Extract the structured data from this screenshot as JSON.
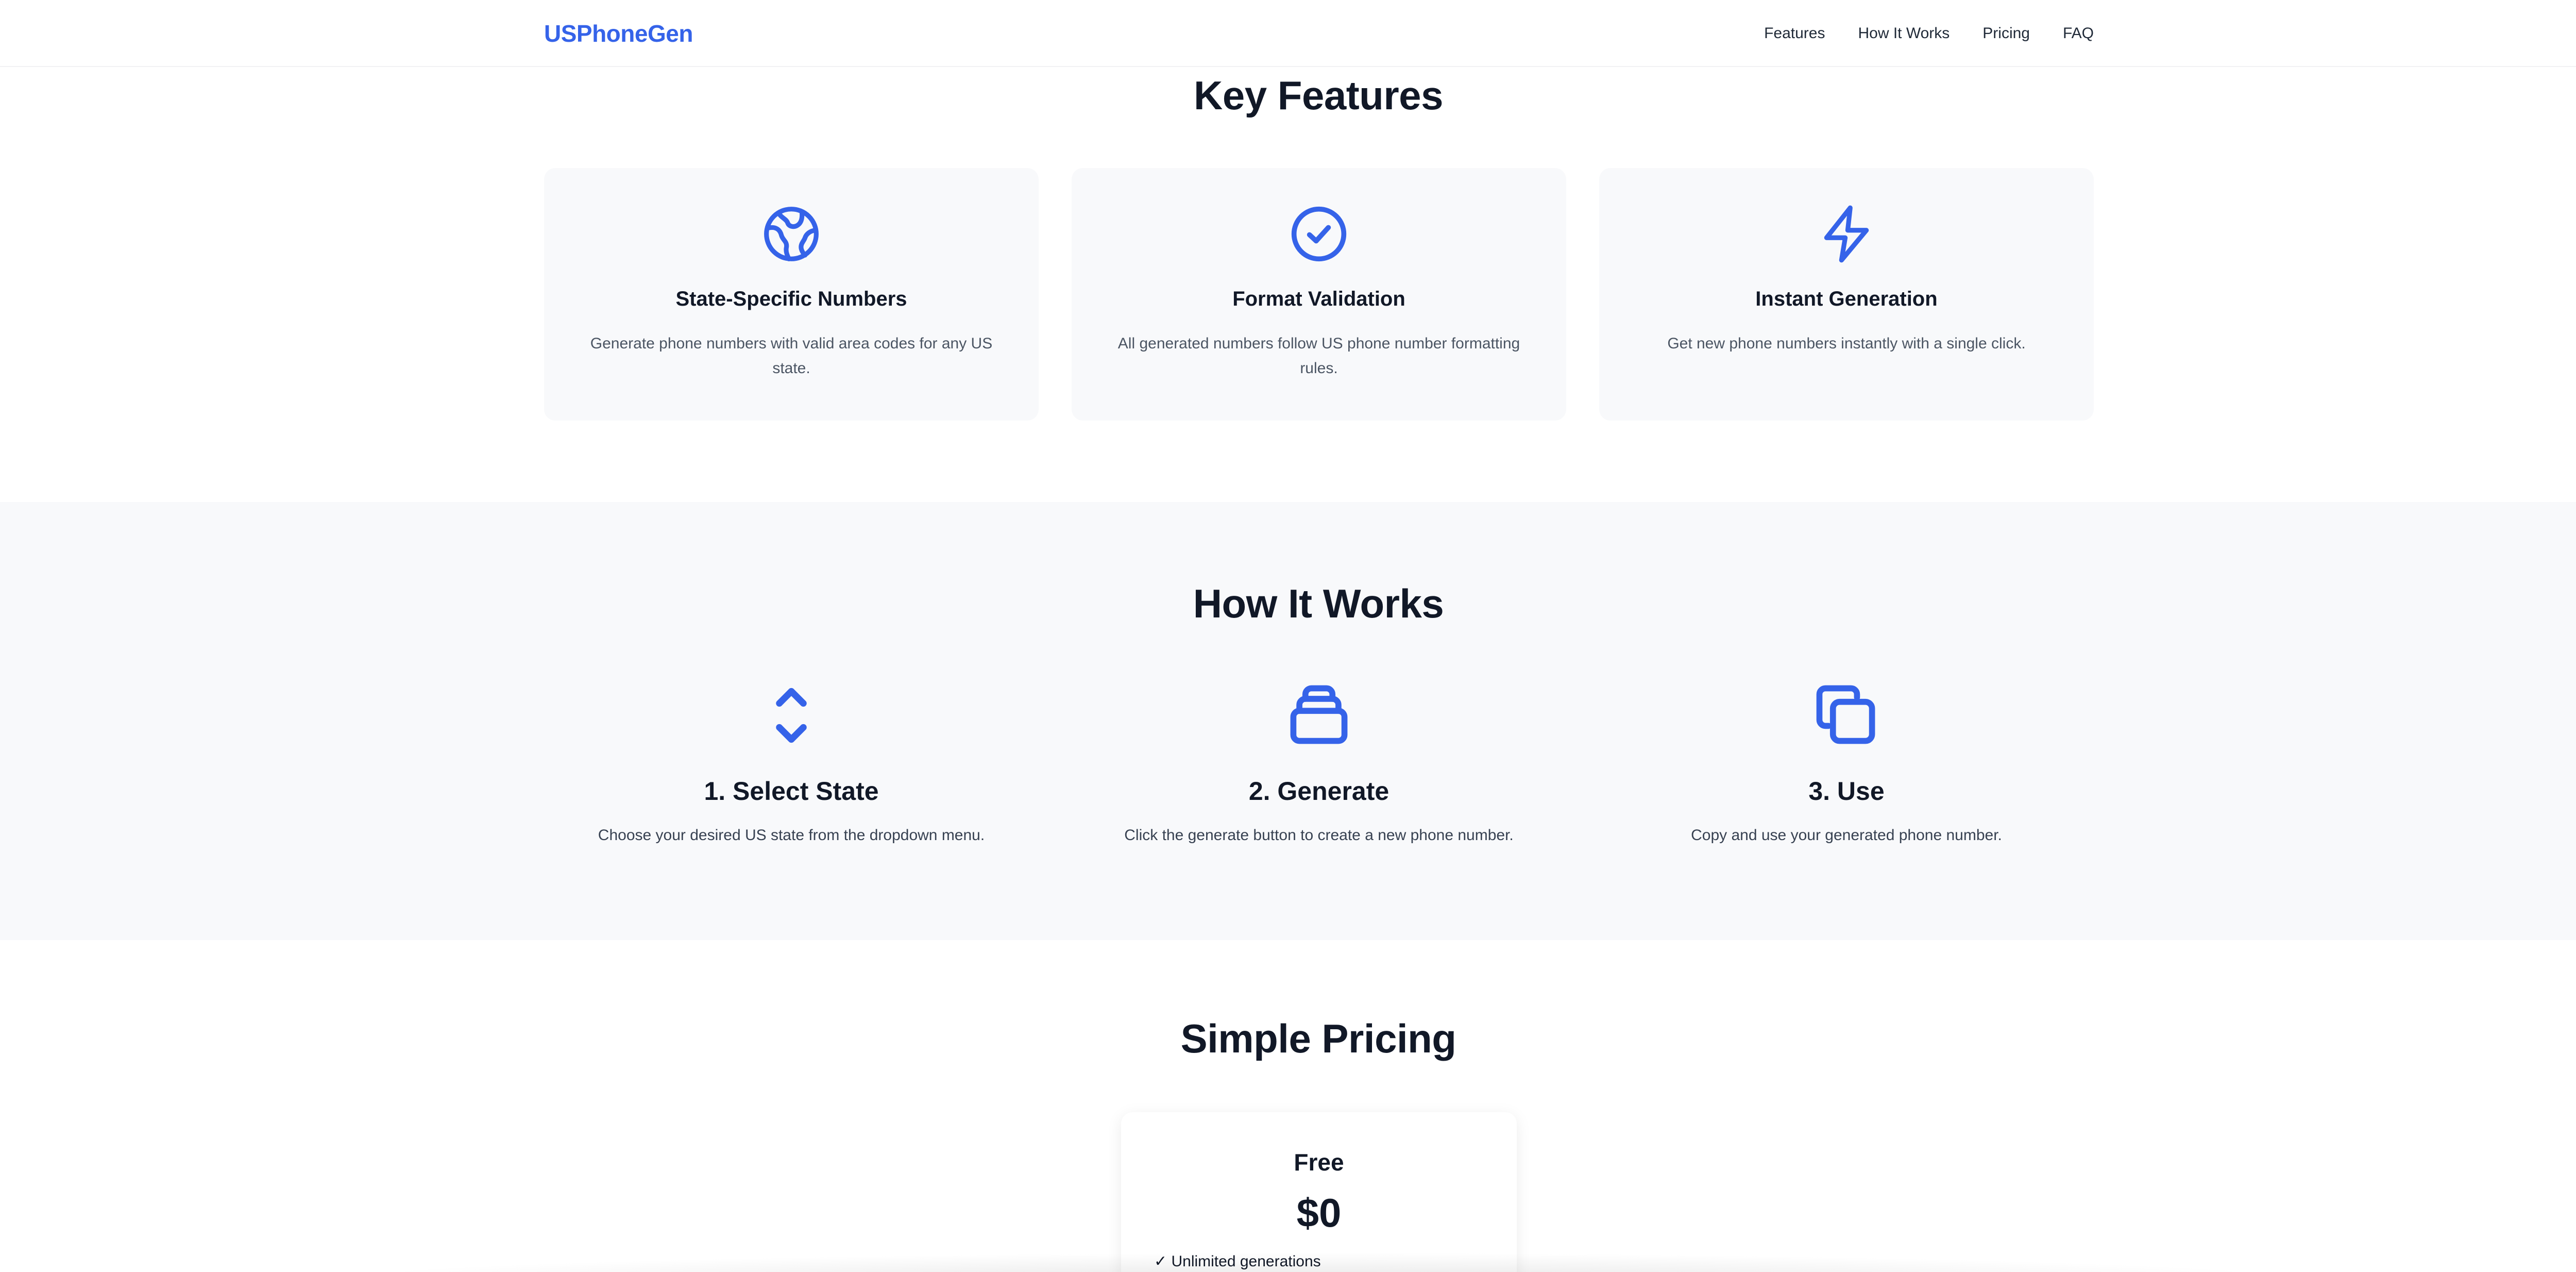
{
  "nav": {
    "brand": "USPhoneGen",
    "links": [
      "Features",
      "How It Works",
      "Pricing",
      "FAQ"
    ]
  },
  "features": {
    "title": "Key Features",
    "cards": [
      {
        "icon": "globe-icon",
        "title": "State-Specific Numbers",
        "description": "Generate phone numbers with valid area codes for any US state."
      },
      {
        "icon": "check-circle-icon",
        "title": "Format Validation",
        "description": "All generated numbers follow US phone number formatting rules."
      },
      {
        "icon": "lightning-icon",
        "title": "Instant Generation",
        "description": "Get new phone numbers instantly with a single click."
      }
    ]
  },
  "how_it_works": {
    "title": "How It Works",
    "steps": [
      {
        "icon": "chevron-up-down-icon",
        "title": "1. Select State",
        "description": "Choose your desired US state from the dropdown menu."
      },
      {
        "icon": "stack-icon",
        "title": "2. Generate",
        "description": "Click the generate button to create a new phone number."
      },
      {
        "icon": "copy-icon",
        "title": "3. Use",
        "description": "Copy and use your generated phone number."
      }
    ]
  },
  "pricing": {
    "title": "Simple Pricing",
    "plan": {
      "name": "Free",
      "price": "$0",
      "features": [
        "✓ Unlimited generations"
      ]
    }
  },
  "colors": {
    "accent": "#3563e9",
    "section_bg": "#f8f9fb",
    "heading": "#111827"
  }
}
